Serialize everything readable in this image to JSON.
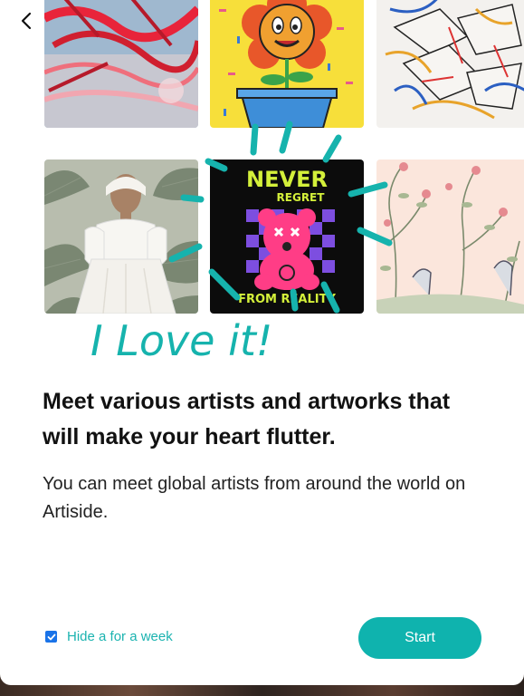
{
  "heading": "Meet various artists and artworks that will make your heart flutter.",
  "description": "You can meet global artists from around the world on Artiside.",
  "hide_checkbox": {
    "label": "Hide a for a week",
    "checked": true
  },
  "start_button": {
    "label": "Start"
  },
  "artwork_text": {
    "overlay_caption": "I Love it!",
    "tshirt_line1": "NEVER",
    "tshirt_line2": "REGRET",
    "tshirt_line3": "FROM REALITY"
  },
  "icons": {
    "back": "chevron-left-icon",
    "check": "checkmark-icon"
  },
  "colors": {
    "accent": "#0fb3ae",
    "checkbox": "#1a73e8",
    "heading": "#111111"
  }
}
